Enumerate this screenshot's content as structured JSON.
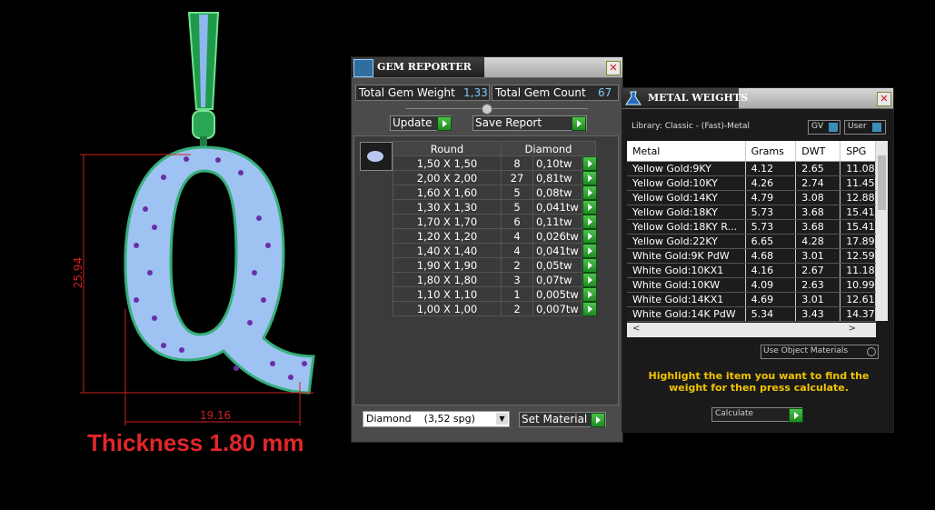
{
  "render": {
    "dimension_height": "25.94",
    "dimension_width": "19.16",
    "thickness_label": "Thickness 1.80 mm"
  },
  "gem_reporter": {
    "title": "GEM REPORTER",
    "total_weight_label": "Total Gem Weight",
    "total_weight_value": "1,33",
    "total_count_label": "Total Gem Count",
    "total_count_value": "67",
    "update_label": "Update",
    "save_label": "Save Report",
    "col_shape": "Round",
    "col_material": "Diamond",
    "rows": [
      {
        "size": "1,50 X 1,50",
        "count": "8",
        "weight": "0,10tw"
      },
      {
        "size": "2,00 X 2,00",
        "count": "27",
        "weight": "0,81tw"
      },
      {
        "size": "1,60 X 1,60",
        "count": "5",
        "weight": "0,08tw"
      },
      {
        "size": "1,30 X 1,30",
        "count": "5",
        "weight": "0,041tw"
      },
      {
        "size": "1,70 X 1,70",
        "count": "6",
        "weight": "0,11tw"
      },
      {
        "size": "1,20 X 1,20",
        "count": "4",
        "weight": "0,026tw"
      },
      {
        "size": "1,40 X 1,40",
        "count": "4",
        "weight": "0,041tw"
      },
      {
        "size": "1,90 X 1,90",
        "count": "2",
        "weight": "0,05tw"
      },
      {
        "size": "1,80 X 1,80",
        "count": "3",
        "weight": "0,07tw"
      },
      {
        "size": "1,10 X 1,10",
        "count": "1",
        "weight": "0,005tw"
      },
      {
        "size": "1,00 X 1,00",
        "count": "2",
        "weight": "0,007tw"
      }
    ],
    "material_select": "Diamond    (3,52 spg)",
    "set_material_label": "Set Material"
  },
  "metal_weights": {
    "title": "METAL WEIGHTS",
    "library": "Library: Classic - (Fast)-Metal",
    "gv_label": "GV",
    "user_label": "User",
    "headers": [
      "Metal",
      "Grams",
      "DWT",
      "SPG"
    ],
    "rows": [
      [
        "Yellow Gold:9KY",
        "4.12",
        "2.65",
        "11.08"
      ],
      [
        "Yellow Gold:10KY",
        "4.26",
        "2.74",
        "11.45"
      ],
      [
        "Yellow Gold:14KY",
        "4.79",
        "3.08",
        "12.88"
      ],
      [
        "Yellow Gold:18KY",
        "5.73",
        "3.68",
        "15.41"
      ],
      [
        "Yellow Gold:18KY R...",
        "5.73",
        "3.68",
        "15.41"
      ],
      [
        "Yellow Gold:22KY",
        "6.65",
        "4.28",
        "17.89"
      ],
      [
        "White Gold:9K PdW",
        "4.68",
        "3.01",
        "12.59"
      ],
      [
        "White Gold:10KX1",
        "4.16",
        "2.67",
        "11.18"
      ],
      [
        "White Gold:10KW",
        "4.09",
        "2.63",
        "10.99"
      ],
      [
        "White Gold:14KX1",
        "4.69",
        "3.01",
        "12.61"
      ],
      [
        "White Gold:14K PdW",
        "5.34",
        "3.43",
        "14.37"
      ]
    ],
    "use_object_materials": "Use Object Materials",
    "hint": "Highlight the item you want to find the weight for then press calculate.",
    "calculate_label": "Calculate"
  }
}
